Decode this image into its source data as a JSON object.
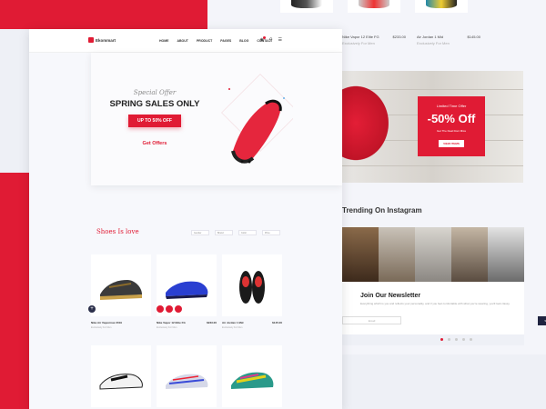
{
  "hero": {
    "special": "Special Offer",
    "headline": "SPRING SALES ONLY",
    "cta": "UP TO 50% OFF",
    "link": "Get Offers"
  },
  "nav": {
    "logo": "Ekommart",
    "items": [
      "HOME",
      "ABOUT",
      "PRODUCT",
      "PAGES",
      "BLOG",
      "CONTACT"
    ]
  },
  "shoes_section": {
    "title": "Shoes Is love",
    "filters": [
      "Gender",
      "Brand",
      "Color",
      "Price"
    ]
  },
  "products": [
    {
      "name": "Nike Air Vapormax 2019",
      "price": "",
      "sub": "Exclusively For Men"
    },
    {
      "name": "Nike Vapor 12 Elite FG",
      "price": "$233.00",
      "sub": "Exclusively For Men"
    },
    {
      "name": "Air Jordan 1 Mid",
      "price": "$145.00",
      "sub": "Exclusively For Men"
    },
    {
      "name": "",
      "price": "",
      "sub": ""
    },
    {
      "name": "",
      "price": "",
      "sub": ""
    },
    {
      "name": "",
      "price": "",
      "sub": ""
    }
  ],
  "back_products": [
    {
      "name": "Nike Vapor 12 Elite FG",
      "price": "$233.00",
      "sub": "Exclusively For Men"
    },
    {
      "name": "Air Jordan 1 Mid",
      "price": "$145.00",
      "sub": "Exclusively For Men"
    }
  ],
  "banner": {
    "limited": "Limited Time Offer",
    "discount": "-50% Off",
    "note": "Get The Deal Dont Miss",
    "button": "VIEW ITEMS"
  },
  "instagram": {
    "title": "Trending On Instagram"
  },
  "newsletter": {
    "title": "Join Our Newsletter",
    "text": "Everything which is you and reflects your personality, and if you feel comfortable with what you're wearing, you'll look classy.",
    "placeholder": "Email",
    "button": "Subscribe"
  },
  "colors": {
    "accent": "#e01b34",
    "dark": "#2b2f4a"
  }
}
